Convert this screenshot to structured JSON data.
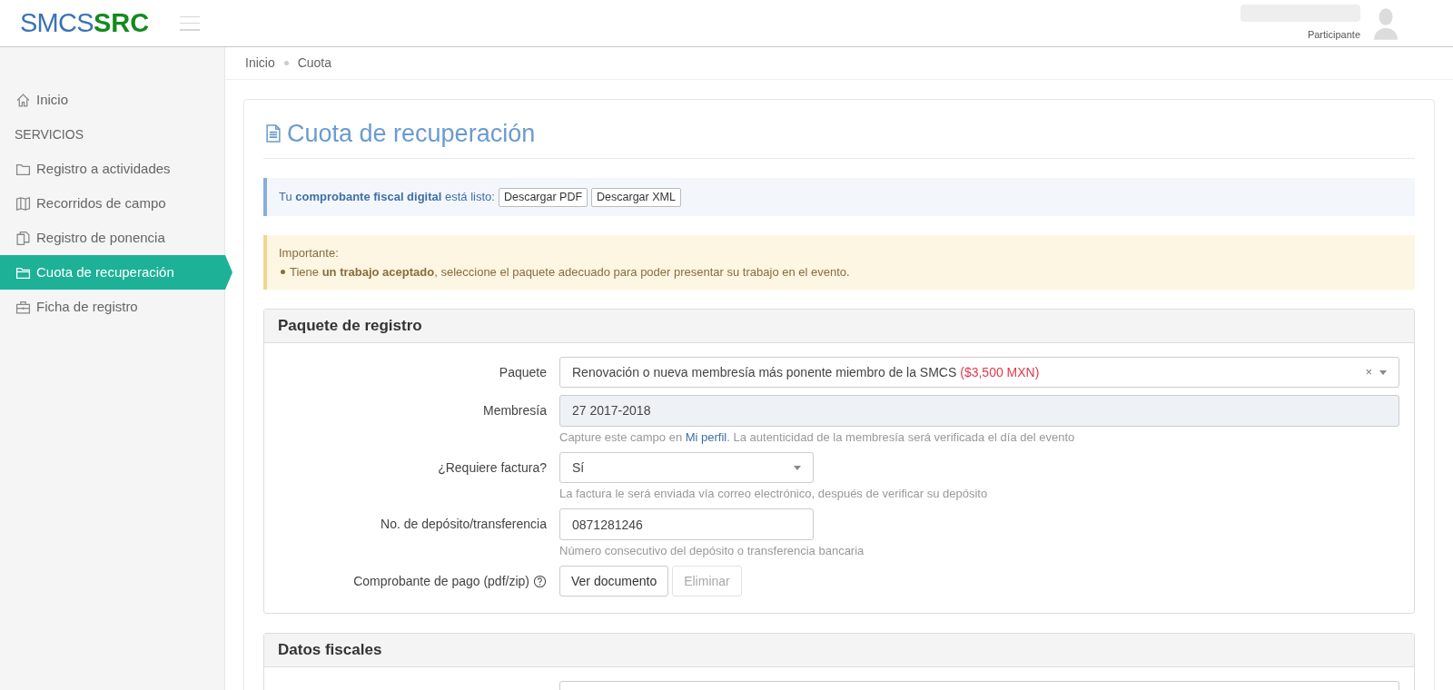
{
  "header": {
    "logo_part_1": "SMCS",
    "logo_part_2": "SRC",
    "user_role": "Participante"
  },
  "sidebar": {
    "items": [
      {
        "kind": "link",
        "label": "Inicio",
        "selected": false
      },
      {
        "kind": "heading",
        "label": "SERVICIOS"
      },
      {
        "kind": "link",
        "label": "Registro a actividades",
        "selected": false
      },
      {
        "kind": "link",
        "label": "Recorridos de campo",
        "selected": false
      },
      {
        "kind": "link",
        "label": "Registro de ponencia",
        "selected": false
      },
      {
        "kind": "link",
        "label": "Cuota de recuperación",
        "selected": true
      },
      {
        "kind": "link",
        "label": "Ficha de registro",
        "selected": false
      }
    ]
  },
  "breadcrumb": [
    "Inicio",
    "Cuota"
  ],
  "page_title": "Cuota de recuperación",
  "info_alert": {
    "text": "Tu **comprobante fiscal digital** está listo:",
    "buttons": [
      "Descargar PDF",
      "Descargar XML"
    ]
  },
  "warning_alert": {
    "title": "Importante:",
    "items": [
      "Tiene **un trabajo aceptado**, seleccione el paquete adecuado para poder presentar su trabajo en el evento."
    ]
  },
  "panels": [
    {
      "title": "Paquete de registro",
      "fields": [
        {
          "kind": "select-clear",
          "label": "Paquete",
          "value": "Renovación o nueva membresía más ponente miembro de la SMCS",
          "price": "($3,500 MXN)",
          "clear": "×"
        },
        {
          "kind": "readonly",
          "label": "Membresía",
          "value": "27 2017-2018",
          "help_before": "Capture este campo en",
          "help_link": "Mi perfil",
          "help_after": ". La autenticidad de la membresía será verificada el día del evento"
        },
        {
          "kind": "select",
          "label": "¿Requiere factura?",
          "value": "Sí",
          "help": "La factura le será enviada vía correo electrónico, después de verificar su depósito"
        },
        {
          "kind": "input",
          "label": "No. de depósito/transferencia",
          "value": "0871281246",
          "help": "Número consecutivo del depósito o transferencia bancaria"
        },
        {
          "kind": "file",
          "label": "Comprobante de pago (pdf/zip)",
          "buttons": [
            {
              "label": "Ver documento",
              "disabled": false
            },
            {
              "label": "Eliminar",
              "disabled": true
            }
          ]
        }
      ]
    },
    {
      "title": "Datos fiscales",
      "fields": [
        {
          "kind": "input"
        }
      ]
    }
  ]
}
